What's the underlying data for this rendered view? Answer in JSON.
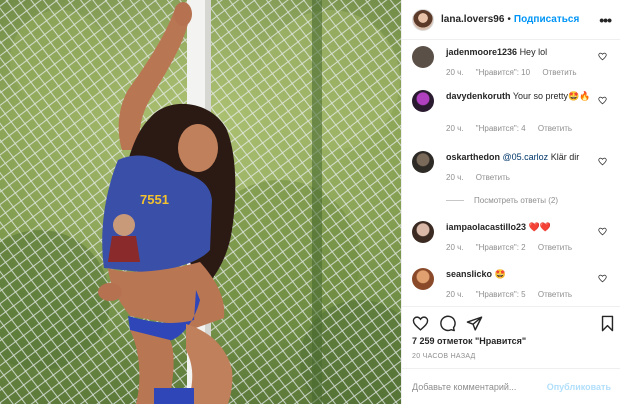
{
  "header": {
    "username": "lana.lovers96",
    "separator": "•",
    "follow_label": "Подписаться",
    "more_icon": "more-horizontal-icon"
  },
  "comments": [
    {
      "username": "jadenmoore1236",
      "text": "Hey lol",
      "time": "20 ч.",
      "likes": "\"Нравится\": 10",
      "reply": "Ответить",
      "avatar_color": "#5a5048"
    },
    {
      "username": "davydenkoruth",
      "text": "Your so pretty🤩🔥",
      "time": "20 ч.",
      "likes": "\"Нравится\": 4",
      "reply": "Ответить",
      "avatar_color": "#3a2a4a"
    },
    {
      "username": "oskarthedon",
      "mention": "@05.carloz",
      "text": " Klär dir",
      "time": "20 ч.",
      "reply": "Ответить",
      "avatar_color": "#2e2a26",
      "view_replies": "Посмотреть ответы (2)"
    },
    {
      "username": "iampaolacastillo23",
      "text": "❤️❤️",
      "time": "20 ч.",
      "likes": "\"Нравится\": 2",
      "reply": "Ответить",
      "avatar_color": "#b89c90"
    },
    {
      "username": "seanslicko",
      "text": "🤩",
      "time": "20 ч.",
      "likes": "\"Нравится\": 5",
      "reply": "Ответить",
      "avatar_color": "#c08060"
    }
  ],
  "actions": {
    "like_icon": "heart-icon",
    "comment_icon": "comment-icon",
    "share_icon": "share-icon",
    "save_icon": "bookmark-icon"
  },
  "likes_text": "7 259 отметок \"Нравится\"",
  "timestamp": "20 ЧАСОВ НАЗАД",
  "add_comment": {
    "placeholder": "Добавьте комментарий...",
    "post_label": "Опубликовать"
  },
  "photo": {
    "shirt_text": "7551",
    "description_icon": "photo"
  }
}
